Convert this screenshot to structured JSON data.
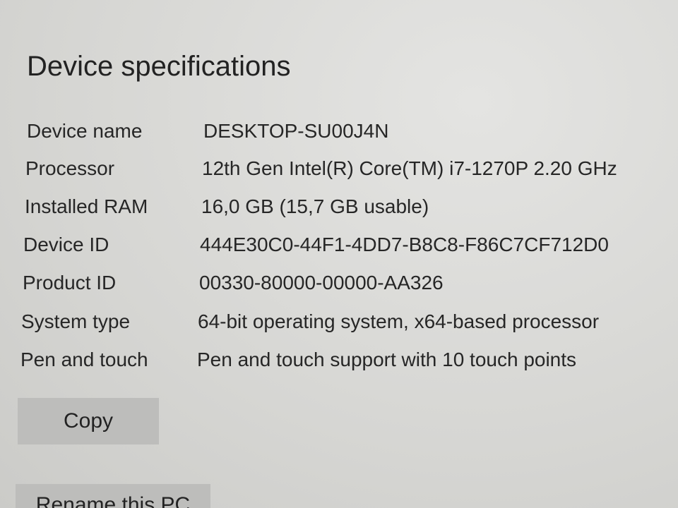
{
  "section": {
    "title": "Device specifications"
  },
  "specs": [
    {
      "label": "Device name",
      "value": "DESKTOP-SU00J4N"
    },
    {
      "label": "Processor",
      "value": "12th Gen Intel(R) Core(TM) i7-1270P   2.20 GHz"
    },
    {
      "label": "Installed RAM",
      "value": "16,0 GB (15,7 GB usable)"
    },
    {
      "label": "Device ID",
      "value": "444E30C0-44F1-4DD7-B8C8-F86C7CF712D0"
    },
    {
      "label": "Product ID",
      "value": "00330-80000-00000-AA326"
    },
    {
      "label": "System type",
      "value": "64-bit operating system, x64-based processor"
    },
    {
      "label": "Pen and touch",
      "value": "Pen and touch support with 10 touch points"
    }
  ],
  "buttons": {
    "copy_label": "Copy",
    "rename_label": "Rename this PC"
  }
}
